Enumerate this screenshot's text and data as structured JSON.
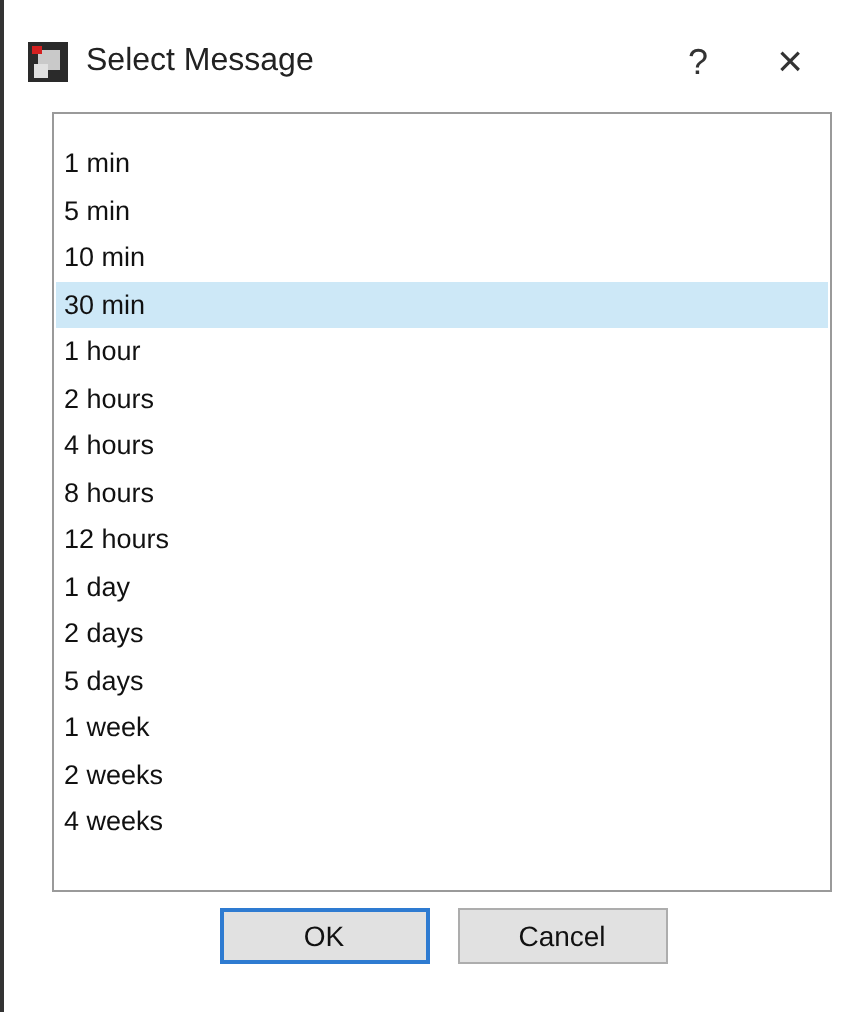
{
  "window": {
    "title": "Select Message"
  },
  "title_buttons": [
    "?",
    "×"
  ],
  "list": {
    "items": [
      {
        "label": "1 min",
        "selected": false
      },
      {
        "label": "5 min",
        "selected": false
      },
      {
        "label": "10 min",
        "selected": false
      },
      {
        "label": "30 min",
        "selected": true
      },
      {
        "label": "1 hour",
        "selected": false
      },
      {
        "label": "2 hours",
        "selected": false
      },
      {
        "label": "4 hours",
        "selected": false
      },
      {
        "label": "8 hours",
        "selected": false
      },
      {
        "label": "12 hours",
        "selected": false
      },
      {
        "label": "1 day",
        "selected": false
      },
      {
        "label": "2 days",
        "selected": false
      },
      {
        "label": "5 days",
        "selected": false
      },
      {
        "label": "1 week",
        "selected": false
      },
      {
        "label": "2 weeks",
        "selected": false
      },
      {
        "label": "4 weeks",
        "selected": false
      }
    ]
  },
  "buttons": [
    {
      "label": "OK",
      "default": true
    },
    {
      "label": "Cancel",
      "default": false
    }
  ]
}
